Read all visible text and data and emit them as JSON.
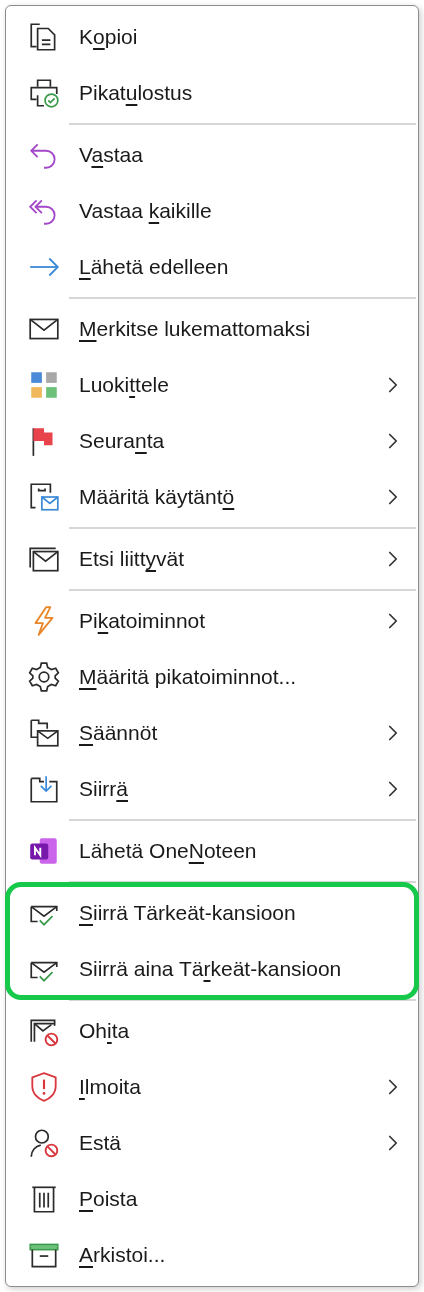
{
  "context_menu": {
    "groups": [
      {
        "highlighted": false,
        "items": [
          {
            "label": {
              "before": "K",
              "key": "o",
              "after": "pioi"
            },
            "submenu": false
          },
          {
            "label": {
              "before": "Pikat",
              "key": "u",
              "after": "lostus"
            },
            "submenu": false
          }
        ]
      },
      {
        "highlighted": false,
        "items": [
          {
            "label": {
              "before": "V",
              "key": "a",
              "after": "staa"
            },
            "submenu": false
          },
          {
            "label": {
              "before": "Vastaa ",
              "key": "k",
              "after": "aikille"
            },
            "submenu": false
          },
          {
            "label": {
              "key": "L",
              "after": "ähetä edelleen"
            },
            "submenu": false
          }
        ]
      },
      {
        "highlighted": false,
        "items": [
          {
            "label": {
              "key": "M",
              "after": "erkitse lukemattomaksi"
            },
            "submenu": false
          },
          {
            "label": {
              "before": "Luoki",
              "key": "t",
              "after": "tele"
            },
            "submenu": true
          },
          {
            "label": {
              "before": "Seura",
              "key": "n",
              "after": "ta"
            },
            "submenu": true
          },
          {
            "label": {
              "before": "Määritä käytänt",
              "key": "ö"
            },
            "submenu": true
          }
        ]
      },
      {
        "highlighted": false,
        "items": [
          {
            "label": {
              "before": "Etsi liitt",
              "key": "y",
              "after": "vät"
            },
            "submenu": true
          }
        ]
      },
      {
        "highlighted": false,
        "items": [
          {
            "label": {
              "before": "Pi",
              "key": "k",
              "after": "atoiminnot"
            },
            "submenu": true
          },
          {
            "label": {
              "key": "M",
              "after": "ääritä pikatoiminnot..."
            },
            "submenu": false
          },
          {
            "label": {
              "key": "S",
              "after": "äännöt"
            },
            "submenu": true
          },
          {
            "label": {
              "before": "Siirr",
              "key": "ä"
            },
            "submenu": true
          }
        ]
      },
      {
        "highlighted": false,
        "items": [
          {
            "label": {
              "before": "Lähetä One",
              "key": "N",
              "after": "oteen"
            },
            "submenu": false
          }
        ]
      },
      {
        "highlighted": true,
        "items": [
          {
            "label": {
              "key": "S",
              "after": "iirrä Tärkeät-kansioon"
            },
            "submenu": false
          },
          {
            "label": {
              "before": "Siirrä aina Tä",
              "key": "r",
              "after": "keät-kansioon"
            },
            "submenu": false
          }
        ]
      },
      {
        "highlighted": false,
        "items": [
          {
            "label": {
              "before": "Oh",
              "key": "i",
              "after": "ta"
            },
            "submenu": false
          },
          {
            "label": {
              "key": "I",
              "after": "lmoita"
            },
            "submenu": true
          },
          {
            "label": {
              "before": "Estä"
            },
            "submenu": true
          },
          {
            "label": {
              "key": "P",
              "after": "oista"
            },
            "submenu": false
          },
          {
            "label": {
              "key": "A",
              "after": "rkistoi..."
            },
            "submenu": false
          }
        ]
      }
    ]
  }
}
